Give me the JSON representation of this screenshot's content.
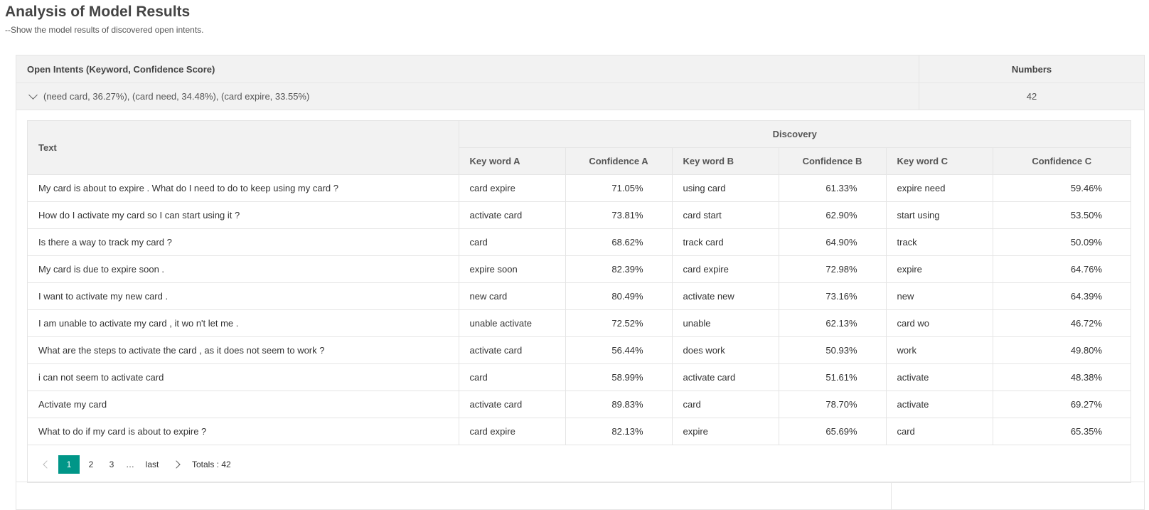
{
  "page": {
    "title": "Analysis of Model Results",
    "subtitle": "--Show the model results of discovered open intents."
  },
  "outer_table": {
    "col_intents": "Open Intents (Keyword, Confidence Score)",
    "col_numbers": "Numbers",
    "group": {
      "label": "(need card, 36.27%), (card need, 34.48%), (card expire, 33.55%)",
      "number": "42",
      "expanded": true
    }
  },
  "inner_table": {
    "col_text": "Text",
    "col_discovery": "Discovery",
    "sub_headers": [
      "Key word A",
      "Confidence A",
      "Key word B",
      "Confidence B",
      "Key word C",
      "Confidence C"
    ],
    "rows": [
      {
        "text": "My card is about to expire . What do I need to do to keep using my card ?",
        "kw_a": "card expire",
        "conf_a": "71.05%",
        "kw_b": "using card",
        "conf_b": "61.33%",
        "kw_c": "expire need",
        "conf_c": "59.46%"
      },
      {
        "text": "How do I activate my card so I can start using it ?",
        "kw_a": "activate card",
        "conf_a": "73.81%",
        "kw_b": "card start",
        "conf_b": "62.90%",
        "kw_c": "start using",
        "conf_c": "53.50%"
      },
      {
        "text": "Is there a way to track my card ?",
        "kw_a": "card",
        "conf_a": "68.62%",
        "kw_b": "track card",
        "conf_b": "64.90%",
        "kw_c": "track",
        "conf_c": "50.09%"
      },
      {
        "text": "My card is due to expire soon .",
        "kw_a": "expire soon",
        "conf_a": "82.39%",
        "kw_b": "card expire",
        "conf_b": "72.98%",
        "kw_c": "expire",
        "conf_c": "64.76%"
      },
      {
        "text": "I want to activate my new card .",
        "kw_a": "new card",
        "conf_a": "80.49%",
        "kw_b": "activate new",
        "conf_b": "73.16%",
        "kw_c": "new",
        "conf_c": "64.39%"
      },
      {
        "text": "I am unable to activate my card , it wo n't let me .",
        "kw_a": "unable activate",
        "conf_a": "72.52%",
        "kw_b": "unable",
        "conf_b": "62.13%",
        "kw_c": "card wo",
        "conf_c": "46.72%"
      },
      {
        "text": "What are the steps to activate the card , as it does not seem to work ?",
        "kw_a": "activate card",
        "conf_a": "56.44%",
        "kw_b": "does work",
        "conf_b": "50.93%",
        "kw_c": "work",
        "conf_c": "49.80%"
      },
      {
        "text": "i can not seem to activate card",
        "kw_a": "card",
        "conf_a": "58.99%",
        "kw_b": "activate card",
        "conf_b": "51.61%",
        "kw_c": "activate",
        "conf_c": "48.38%"
      },
      {
        "text": "Activate my card",
        "kw_a": "activate card",
        "conf_a": "89.83%",
        "kw_b": "card",
        "conf_b": "78.70%",
        "kw_c": "activate",
        "conf_c": "69.27%"
      },
      {
        "text": "What to do if my card is about to expire ?",
        "kw_a": "card expire",
        "conf_a": "82.13%",
        "kw_b": "expire",
        "conf_b": "65.69%",
        "kw_c": "card",
        "conf_c": "65.35%"
      }
    ]
  },
  "pagination": {
    "pages": [
      "1",
      "2",
      "3"
    ],
    "current": "1",
    "ellipsis": "…",
    "last_label": "last",
    "totals": "Totals : 42",
    "accent": "#009688"
  }
}
